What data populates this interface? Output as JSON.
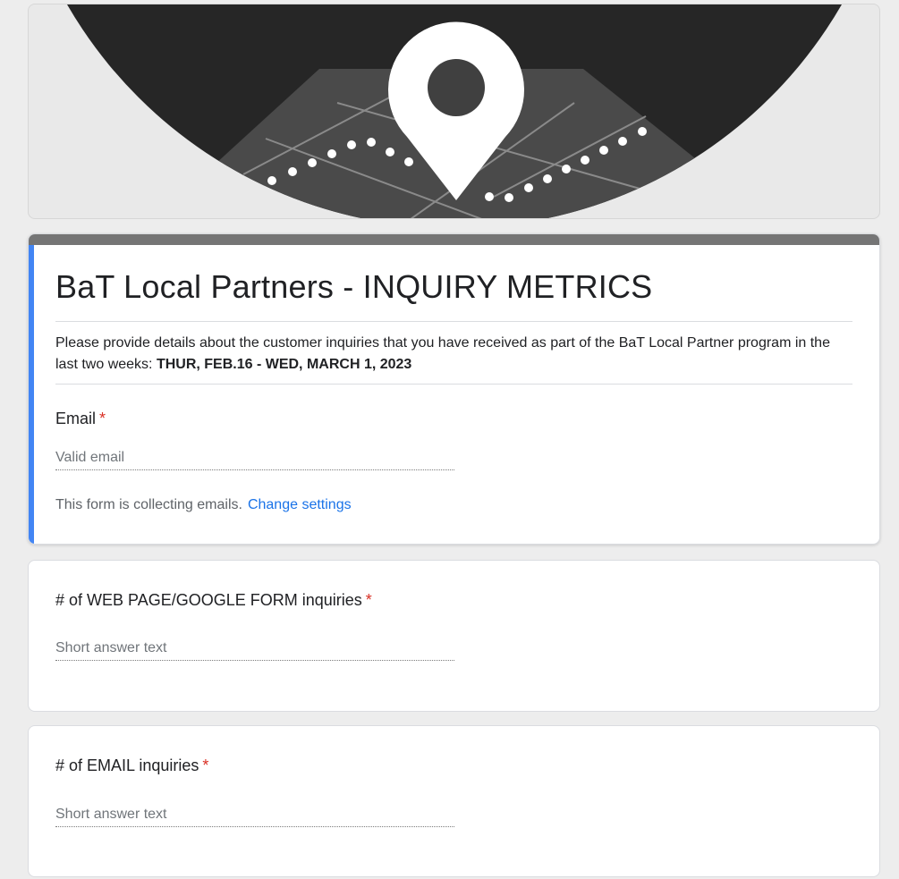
{
  "form": {
    "title": "BaT Local Partners - INQUIRY METRICS",
    "description_text": "Please provide details about the customer inquiries that you have received as part of the BaT Local Partner program in the last two weeks: ",
    "description_bold": "THUR, FEB.16 - WED, MARCH 1, 2023",
    "accent_color": "#4285f4",
    "header_color": "#757575"
  },
  "email": {
    "label": "Email",
    "required_mark": "*",
    "placeholder": "Valid email",
    "note": "This form is collecting emails.",
    "change_link": "Change settings"
  },
  "questions": [
    {
      "label": "# of WEB PAGE/GOOGLE FORM inquiries",
      "required_mark": "*",
      "placeholder": "Short answer text"
    },
    {
      "label": "# of EMAIL inquiries",
      "required_mark": "*",
      "placeholder": "Short answer text"
    }
  ],
  "banner": {
    "icon": "map-pin-icon"
  }
}
